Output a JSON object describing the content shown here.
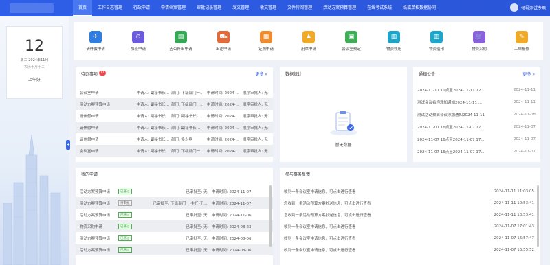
{
  "nav": {
    "items": [
      "首页",
      "工作日志管理",
      "行政申请",
      "申请档案管理",
      "审批记录管理",
      "发文管理",
      "收文管理",
      "文件传阅管理",
      "活动方案预算管理",
      "在线考试系统",
      "纸或单权数据协同"
    ],
    "user_name": "领导测试专用"
  },
  "datecard": {
    "day": "12",
    "date_line": "周二  2024年11月",
    "lunar": "农历十月十二",
    "greeting": "上午好"
  },
  "apps": [
    {
      "label": "请休假申请",
      "color": "#2f7de1",
      "icon": "✈"
    },
    {
      "label": "加班申请",
      "color": "#6a5ae0",
      "icon": "⏱"
    },
    {
      "label": "因公外出申请",
      "color": "#35a853",
      "icon": "▤"
    },
    {
      "label": "出差申请",
      "color": "#e06a3a",
      "icon": "⛟"
    },
    {
      "label": "证照申请",
      "color": "#f08a2e",
      "icon": "▦"
    },
    {
      "label": "用章申请",
      "color": "#f1a928",
      "icon": "♟"
    },
    {
      "label": "会议室预定",
      "color": "#3fae59",
      "icon": "▣"
    },
    {
      "label": "物资领用",
      "color": "#1ea4c8",
      "icon": "▥"
    },
    {
      "label": "物资借用",
      "color": "#1aa7c9",
      "icon": "▥"
    },
    {
      "label": "物资采购",
      "color": "#8a5fe0",
      "icon": "🛒"
    },
    {
      "label": "工单报修",
      "color": "#f1a928",
      "icon": "✎"
    }
  ],
  "todo": {
    "title": "待办事项",
    "badge": "17",
    "more": "更多",
    "rows": [
      {
        "type": "会议室申请",
        "applicant": "申请人: 副秘书长...",
        "dept": "部门: 下级部门一...",
        "time": "申请时间: 2024-...",
        "approver": "顺序审批人: 无"
      },
      {
        "type": "活动方案预算申请",
        "applicant": "申请人: 副秘书长...",
        "dept": "部门: 下级部门一...",
        "time": "申请时间: 2024-...",
        "approver": "顺序审批人: 无"
      },
      {
        "type": "请休假申请",
        "applicant": "申请人: 副秘书长...",
        "dept": "部门: 副秘书长-王...",
        "time": "申请时间: 2024-...",
        "approver": "顺序审批人: 无"
      },
      {
        "type": "请休假申请",
        "applicant": "申请人: 副秘书长...",
        "dept": "部门: 副秘书长-王...",
        "time": "申请时间: 2024-...",
        "approver": "顺序审批人: 无"
      },
      {
        "type": "请休假申请",
        "applicant": "申请人: 副秘书长...",
        "dept": "部门: 多少啊",
        "time": "申请时间: 2024-...",
        "approver": "顺序审批人: 无"
      },
      {
        "type": "会议室申请",
        "applicant": "申请人: 副秘书长...",
        "dept": "部门: 下级部门一...",
        "time": "申请时间: 2024-...",
        "approver": "顺序审批人: 无"
      }
    ]
  },
  "stats": {
    "title": "数据统计",
    "empty": "暂无数据"
  },
  "notice": {
    "title": "通知公告",
    "more": "更多",
    "rows": [
      {
        "text": "2024-11-11 11点至2024-11-11 12...",
        "date": "2024-11-11"
      },
      {
        "text": "测试会议名称添加通知2024-11-11 ...",
        "date": "2024-11-11"
      },
      {
        "text": "测试活动预算会议添加通知2024-11-11",
        "date": "2024-11-08"
      },
      {
        "text": "2024-11-07 16点至2024-11-07 17...",
        "date": "2024-11-07"
      },
      {
        "text": "2024-11-07 16点至2024-11-07 17...",
        "date": "2024-11-07"
      },
      {
        "text": "2024-11-07 16点至2024-11-07 17...",
        "date": "2024-11-07"
      }
    ]
  },
  "my_apply": {
    "title": "我的申请",
    "rows": [
      {
        "type": "活动方案预算申请",
        "status": "已通过",
        "approver": "已审批至: 无",
        "time": "申请时间: 2024-11-07"
      },
      {
        "type": "活动方案预算申请",
        "status": "待审批",
        "approver": "已审批至: 下级部门一-主任-王...",
        "time": "申请时间: 2024-11-07"
      },
      {
        "type": "活动方案预算申请",
        "status": "已通过",
        "approver": "已审批至: 无",
        "time": "申请时间: 2024-11-06"
      },
      {
        "type": "物资采购申请",
        "status": "已通过",
        "approver": "已审批至: 无",
        "time": "申请时间: 2024-08-23"
      },
      {
        "type": "活动方案预算申请",
        "status": "已通过",
        "approver": "已审批至: 无",
        "time": "申请时间: 2024-08-06"
      },
      {
        "type": "活动方案预算申请",
        "status": "已通过",
        "approver": "已审批至: 无",
        "time": "申请时间: 2024-08-06"
      }
    ]
  },
  "feedback": {
    "title": "参与事务反馈",
    "rows": [
      {
        "text": "收到一条会议室申请信息，可点击进行查看",
        "time": "2024-11-11 11:03:05"
      },
      {
        "text": "您收到一条活动预算方案抄送信息，可点击进行查看",
        "time": "2024-11-11 10:53:41"
      },
      {
        "text": "您收到一条活动预算方案抄送信息，可点击进行查看",
        "time": "2024-11-11 10:53:41"
      },
      {
        "text": "收到一条会议室申请信息，可点击进行查看",
        "time": "2024-11-07 17:01:43"
      },
      {
        "text": "收到一条会议室申请信息，可点击进行查看",
        "time": "2024-11-07 16:57:47"
      },
      {
        "text": "收到一条会议室申请信息，可点击进行查看",
        "time": "2024-11-07 16:55:52"
      }
    ]
  }
}
